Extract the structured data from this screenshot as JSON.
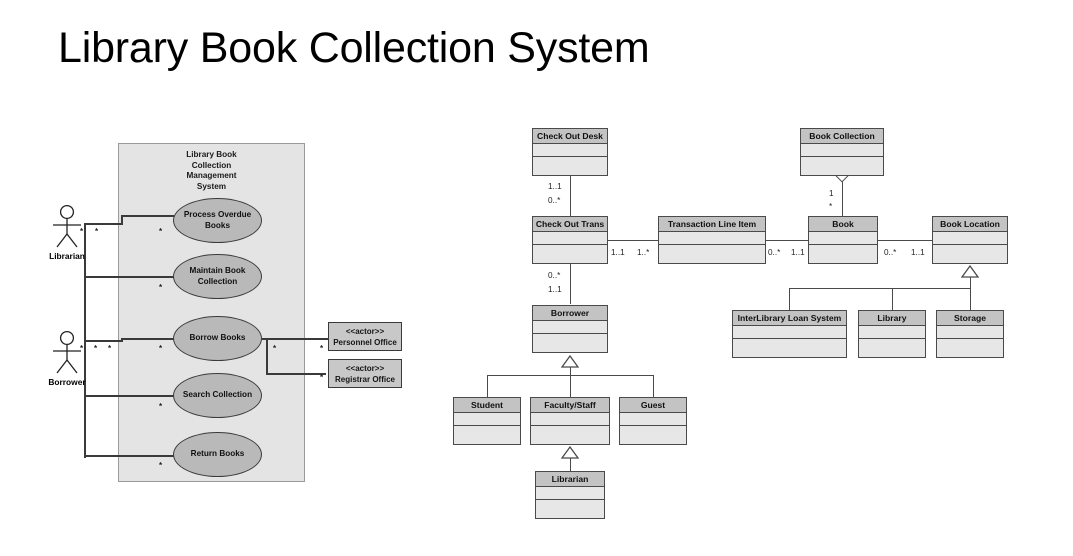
{
  "page": {
    "title": "Library Book Collection System"
  },
  "usecase_diagram": {
    "system_boundary_label": "Library Book\nCollection\nManagement\nSystem",
    "system_boundary_lines": [
      "Library Book",
      "Collection",
      "Management",
      "System"
    ],
    "actors": [
      {
        "id": "librarian",
        "label": "Librarian"
      },
      {
        "id": "borrower",
        "label": "Borrower"
      }
    ],
    "use_cases": [
      {
        "id": "process-overdue-books",
        "label": "Process Overdue\nBooks",
        "lines": [
          "Process Overdue",
          "Books"
        ]
      },
      {
        "id": "maintain-book-collection",
        "label": "Maintain Book\nCollection",
        "lines": [
          "Maintain Book",
          "Collection"
        ]
      },
      {
        "id": "borrow-books",
        "label": "Borrow Books",
        "lines": [
          "Borrow Books"
        ]
      },
      {
        "id": "search-collection",
        "label": "Search Collection",
        "lines": [
          "Search Collection"
        ]
      },
      {
        "id": "return-books",
        "label": "Return Books",
        "lines": [
          "Return Books"
        ]
      }
    ],
    "external_actors": [
      {
        "id": "personnel-office",
        "stereotype": "<<actor>>",
        "label": "Personnel Office"
      },
      {
        "id": "registrar-office",
        "stereotype": "<<actor>>",
        "label": "Registrar Office"
      }
    ],
    "multiplicity_symbol": "*"
  },
  "class_diagram": {
    "classes": [
      {
        "id": "check-out-desk",
        "name": "Check Out Desk"
      },
      {
        "id": "check-out-trans",
        "name": "Check Out Trans"
      },
      {
        "id": "transaction-line-item",
        "name": "Transaction Line Item"
      },
      {
        "id": "book-collection",
        "name": "Book Collection"
      },
      {
        "id": "book",
        "name": "Book"
      },
      {
        "id": "book-location",
        "name": "Book Location"
      },
      {
        "id": "borrower",
        "name": "Borrower"
      },
      {
        "id": "student",
        "name": "Student"
      },
      {
        "id": "faculty-staff",
        "name": "Faculty/Staff"
      },
      {
        "id": "guest",
        "name": "Guest"
      },
      {
        "id": "librarian",
        "name": "Librarian"
      },
      {
        "id": "interlibrary-loan-system",
        "name": "InterLibrary Loan System"
      },
      {
        "id": "library",
        "name": "Library"
      },
      {
        "id": "storage",
        "name": "Storage"
      }
    ],
    "multiplicities": {
      "desk_to_trans_near": "1..1",
      "desk_to_trans_far": "0..*",
      "trans_to_line_near": "1..1",
      "trans_to_line_far": "1..*",
      "line_to_book_near": "0..*",
      "line_to_book_far": "1..1",
      "collection_to_book_near": "1",
      "collection_to_book_far": "*",
      "trans_to_borrower_near": "0..*",
      "trans_to_borrower_far": "1..1",
      "book_to_location_near": "0..*",
      "book_to_location_far": "1..1"
    }
  },
  "colors": {
    "class_header": "#c3c3c3",
    "class_body": "#e7e7e7",
    "usecase_fill": "#b9b9b9",
    "boundary_fill": "#e4e4e4",
    "stroke": "#4a4a4a"
  }
}
